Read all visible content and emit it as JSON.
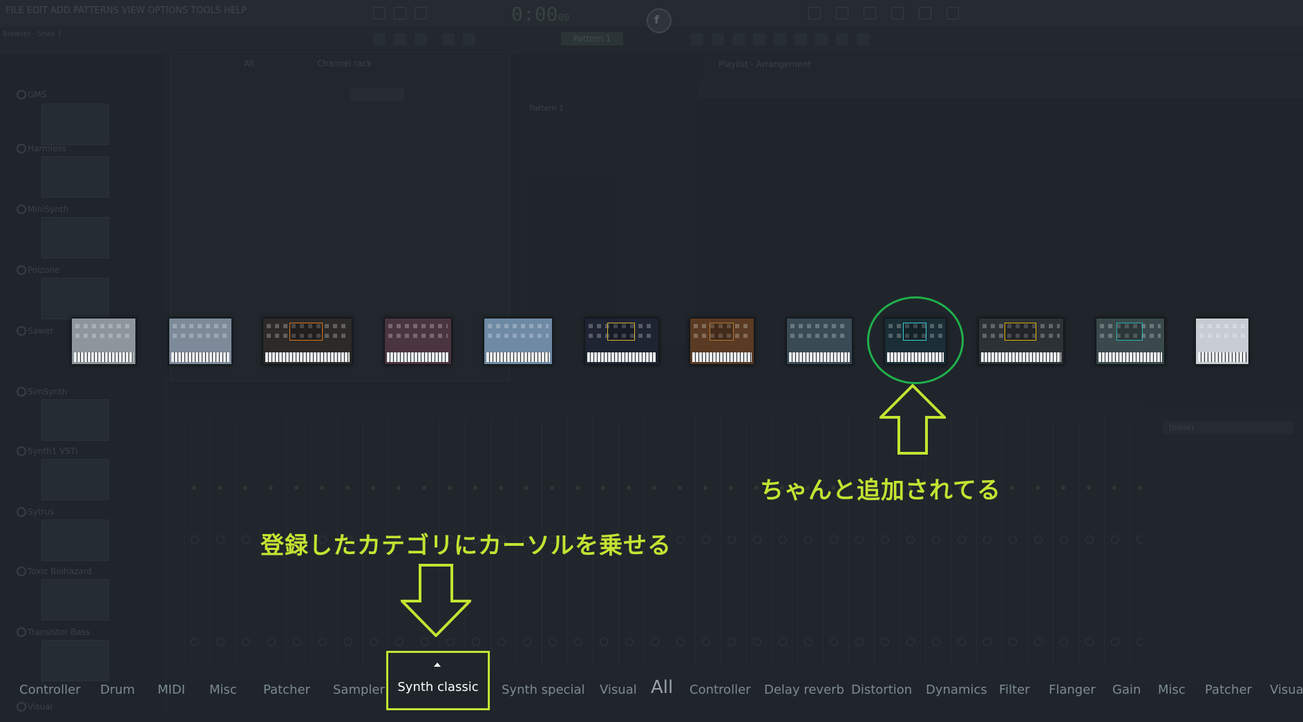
{
  "app": {
    "menu_text": "FILE EDIT ADD PATTERNS VIEW OPTIONS TOOLS HELP",
    "timer": "0:00",
    "timer_small": "00",
    "pattern_label": "Pattern 1",
    "browser_title": "Browser - Snap 1",
    "channel_rack_title": "Channel rack",
    "channel_rack_all": "All",
    "pattern_item": "Pattern 1",
    "playlist_title": "Playlist - Arrangement",
    "mixer_select": "(none)",
    "logo_letter": "f"
  },
  "left_browser": {
    "items": [
      "GMS",
      "Harmless",
      "MiniSynth",
      "Poizone",
      "Sawer",
      "SimSynth",
      "Synth1 VSTi",
      "Sytrus",
      "Toxic Biohazard",
      "Transistor Bass",
      "Visual"
    ]
  },
  "thumbnails": [
    {
      "name": "plugin-thumb-1",
      "bg": "#8d969c"
    },
    {
      "name": "plugin-thumb-2",
      "bg": "#7c8a99"
    },
    {
      "name": "plugin-thumb-3",
      "bg": "#2b2a28",
      "accent": "#e07a1f"
    },
    {
      "name": "plugin-thumb-4",
      "bg": "#4a3440"
    },
    {
      "name": "plugin-thumb-5",
      "bg": "#6f8aa5"
    },
    {
      "name": "plugin-thumb-6",
      "bg": "#1f2433",
      "accent": "#d8b832"
    },
    {
      "name": "plugin-thumb-7",
      "bg": "#5a3a22",
      "accent": "#b47a3c"
    },
    {
      "name": "plugin-thumb-8",
      "bg": "#3a4a55"
    },
    {
      "name": "plugin-thumb-9",
      "bg": "#1a2e35",
      "accent": "#3fd0d8"
    },
    {
      "name": "plugin-thumb-10",
      "bg": "#2c3136",
      "accent": "#e0b400"
    },
    {
      "name": "plugin-thumb-11",
      "bg": "#3a4a4c",
      "accent": "#2fb4b6"
    },
    {
      "name": "plugin-thumb-12",
      "bg": "#c7ccd3"
    }
  ],
  "annotations": {
    "added_text": "ちゃんと追加されてる",
    "hover_text": "登録したカテゴリにカーソルを乗せる",
    "highlight_color": "#c4e332",
    "circle_color": "#20b04c"
  },
  "categories": [
    {
      "label": "Controller"
    },
    {
      "label": "Drum"
    },
    {
      "label": "MIDI"
    },
    {
      "label": "Misc"
    },
    {
      "label": "Patcher"
    },
    {
      "label": "Sampler"
    },
    {
      "label": "Synth classic",
      "selected": true
    },
    {
      "label": "Synth special"
    },
    {
      "label": "Visual"
    },
    {
      "label": "All"
    },
    {
      "label": "Controller"
    },
    {
      "label": "Delay reverb"
    },
    {
      "label": "Distortion"
    },
    {
      "label": "Dynamics"
    },
    {
      "label": "Filter"
    },
    {
      "label": "Flanger"
    },
    {
      "label": "Gain"
    },
    {
      "label": "Misc"
    },
    {
      "label": "Patcher"
    },
    {
      "label": "Visual"
    }
  ]
}
